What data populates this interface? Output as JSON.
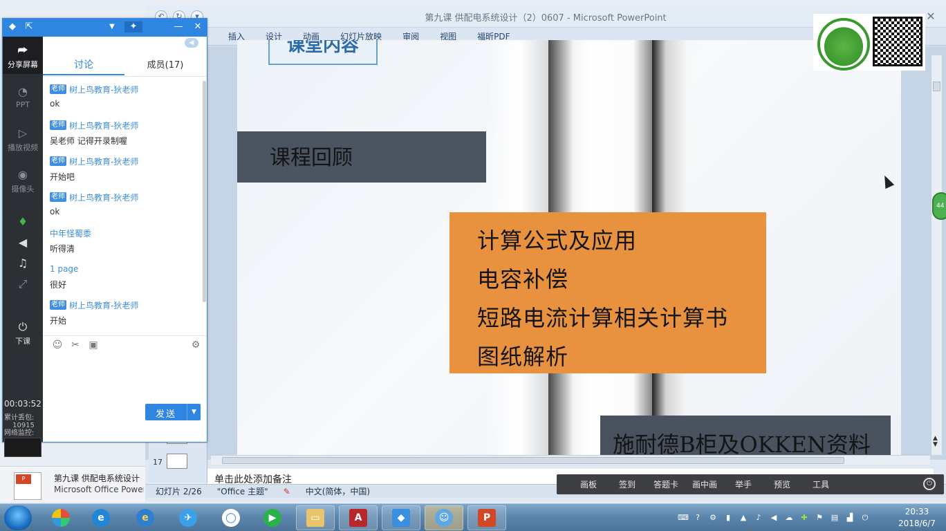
{
  "ppt": {
    "title": "第九课 供配电系统设计（2）0607 - Microsoft PowerPoint",
    "close": "✕",
    "tabs": [
      "插入",
      "设计",
      "动画",
      "幻灯片放映",
      "审阅",
      "视图",
      "福昕PDF"
    ],
    "slide_top_title": "课堂内容",
    "review_title": "课程回顾",
    "content_lines": [
      "计算公式及应用",
      "电容补偿",
      "短路电流计算相关计算书",
      "图纸解析"
    ],
    "bottom_text": "施耐德B柜及OKKEN资料",
    "thumb_number": "17",
    "notes_placeholder": "单击此处添加备注",
    "status": {
      "slide": "幻灯片 2/26",
      "theme": "\"Office 主题\"",
      "language": "中文(简体，中国)"
    }
  },
  "class_toolbar": {
    "items": [
      "画板",
      "签到",
      "答题卡",
      "画中画",
      "举手",
      "预览",
      "工具"
    ]
  },
  "chat": {
    "sidebar": {
      "share_screen": "分享屏幕",
      "ppt": "PPT",
      "play_video": "播放视频",
      "camera": "摄像头",
      "end_class": "下课"
    },
    "timer": "00:03:52",
    "stats": {
      "packet_loss_label": "累计丢包:",
      "packet_loss_value": "10915",
      "network_label": "网络监控:"
    },
    "tabs": {
      "discuss": "讨论",
      "members": "成员(17)"
    },
    "messages": [
      {
        "badge": "老师",
        "name": "树上鸟教育-狄老师",
        "text": "ok"
      },
      {
        "badge": "老师",
        "name": "树上鸟教育-狄老师",
        "text": "吴老师 记得开录制喔"
      },
      {
        "badge": "老师",
        "name": "树上鸟教育-狄老师",
        "text": "开始吧"
      },
      {
        "badge": "老师",
        "name": "树上鸟教育-狄老师",
        "text": "ok"
      },
      {
        "badge": "",
        "name": "中年怪蜀黍",
        "text": "听得清"
      },
      {
        "badge": "",
        "name": "1 page",
        "text": "很好"
      },
      {
        "badge": "老师",
        "name": "树上鸟教育-狄老师",
        "text": "开始"
      }
    ],
    "send_label": "发送"
  },
  "file_preview": {
    "name": "第九课 供配电系统设计",
    "app": "Microsoft Office Power"
  },
  "taskbar": {
    "clock_time": "20:33",
    "clock_date": "2018/6/7"
  },
  "edge_badge": "44",
  "icons": {
    "share": "share-screen-icon",
    "ppt": "ppt-icon",
    "video": "play-video-icon",
    "camera": "camera-icon",
    "mic": "microphone-icon",
    "speaker": "speaker-icon",
    "music": "music-icon",
    "fullscreen": "fullscreen-icon",
    "exit": "end-class-icon"
  },
  "colors": {
    "chat_accent": "#2f86e0",
    "orange_box": "#e8913f",
    "dark_band": "#4b5461"
  }
}
